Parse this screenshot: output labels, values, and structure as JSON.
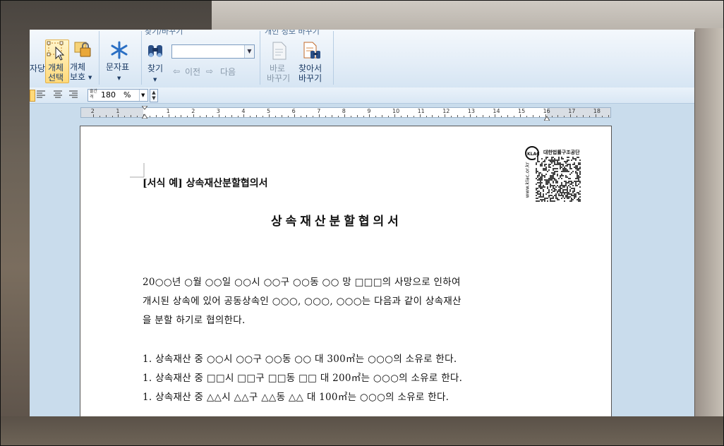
{
  "ribbon": {
    "partial_left_label": "자당",
    "object_select": {
      "line1": "개체",
      "line2": "선택"
    },
    "object_protect": {
      "line1": "개체",
      "line2": "보호"
    },
    "char_table": "문자표",
    "find_replace_group": "찾기/바꾸기",
    "find_label": "찾기",
    "prev_label": "이전",
    "next_label": "다음",
    "find_input_value": "",
    "change_tracking_group": "개인 정보 바꾸기",
    "direct_replace": {
      "line1": "바로",
      "line2": "바꾸기"
    },
    "find_replace_btn": {
      "line1": "찾아서",
      "line2": "바꾸기"
    }
  },
  "format_bar": {
    "spacing_label": "줄간격",
    "zoom_value": "180",
    "zoom_unit": "%"
  },
  "ruler": {
    "numbers": [
      "2",
      "1",
      "1",
      "2",
      "3",
      "4",
      "5",
      "6",
      "7",
      "8",
      "9",
      "10",
      "11",
      "12",
      "13",
      "14",
      "15",
      "16",
      "17",
      "18"
    ]
  },
  "document": {
    "form_label": "[서식 예] 상속재산분할협의서",
    "title": "상속재산분할협의서",
    "paragraph": [
      "20○○년 ○월 ○○일 ○○시 ○○구 ○○동 ○○ 망 □□□의 사망으로 인하여",
      "개시된 상속에 있어 공동상속인 ○○○, ○○○, ○○○는 다음과 같이 상속재산",
      "을 분할 하기로 협의한다."
    ],
    "items": [
      "1. 상속재산 중 ○○시 ○○구 ○○동 ○○ 대 300㎡는 ○○○의 소유로 한다.",
      "1. 상속재산 중 □□시 □□구 □□동 □□ 대 200㎡는 ○○○의 소유로 한다.",
      "1. 상속재산 중 △△시 △△구 △△동 △△ 대 100㎡는 ○○○의 소유로 한다."
    ],
    "seal_text": "대한법률구조공단",
    "seal_url": "www.klac.or.kr",
    "seal_logo": "KLAC"
  },
  "colors": {
    "ribbon_bg": "#e3edf7",
    "accent_text": "#1e3d66",
    "selected_button": "#ffd97a"
  }
}
